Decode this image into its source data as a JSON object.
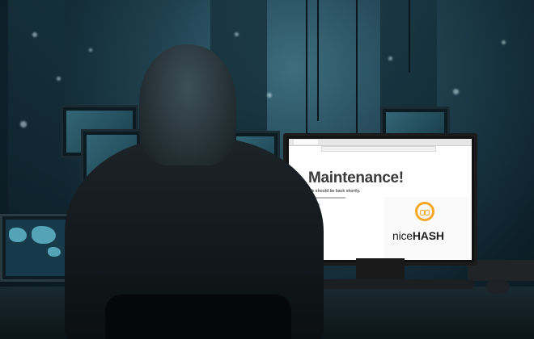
{
  "monitor_page": {
    "heading": "Maintenance!",
    "subheading": "We should be back shortly.",
    "logo": {
      "brand_light": "nice",
      "brand_bold": "HASH",
      "accent_color": "#f6a821"
    }
  },
  "palette": {
    "room_tint": "#1e3f4d",
    "screen_bg": "#ffffff",
    "heading_color": "#3a3a3a"
  }
}
